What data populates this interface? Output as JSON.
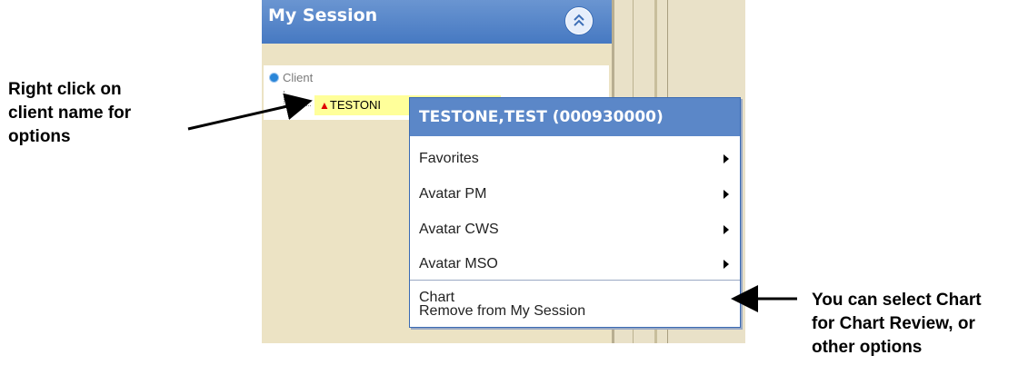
{
  "panel": {
    "title": "My Session",
    "collapse_icon": "double-chevron-up-icon",
    "accent_color": "#4679c2"
  },
  "tree": {
    "root_label": "Client",
    "client_label": "TESTONE,TEST",
    "client_visible_text": "TESTONI",
    "warning_glyph": "▲",
    "highlight_color": "#ffff9a"
  },
  "context_menu": {
    "header": "TESTONE,TEST (000930000)",
    "items": [
      {
        "label": "Favorites",
        "submenu": true
      },
      {
        "label": "Avatar PM",
        "submenu": true
      },
      {
        "label": "Avatar CWS",
        "submenu": true
      },
      {
        "label": "Avatar MSO",
        "submenu": true
      },
      {
        "label": "Chart",
        "submenu": false
      },
      {
        "label": "Remove from My Session",
        "submenu": false
      }
    ]
  },
  "annotations": {
    "left_note": "Right click on\nclient name for\noptions",
    "right_note": "You can select Chart\nfor Chart Review, or\nother options"
  }
}
